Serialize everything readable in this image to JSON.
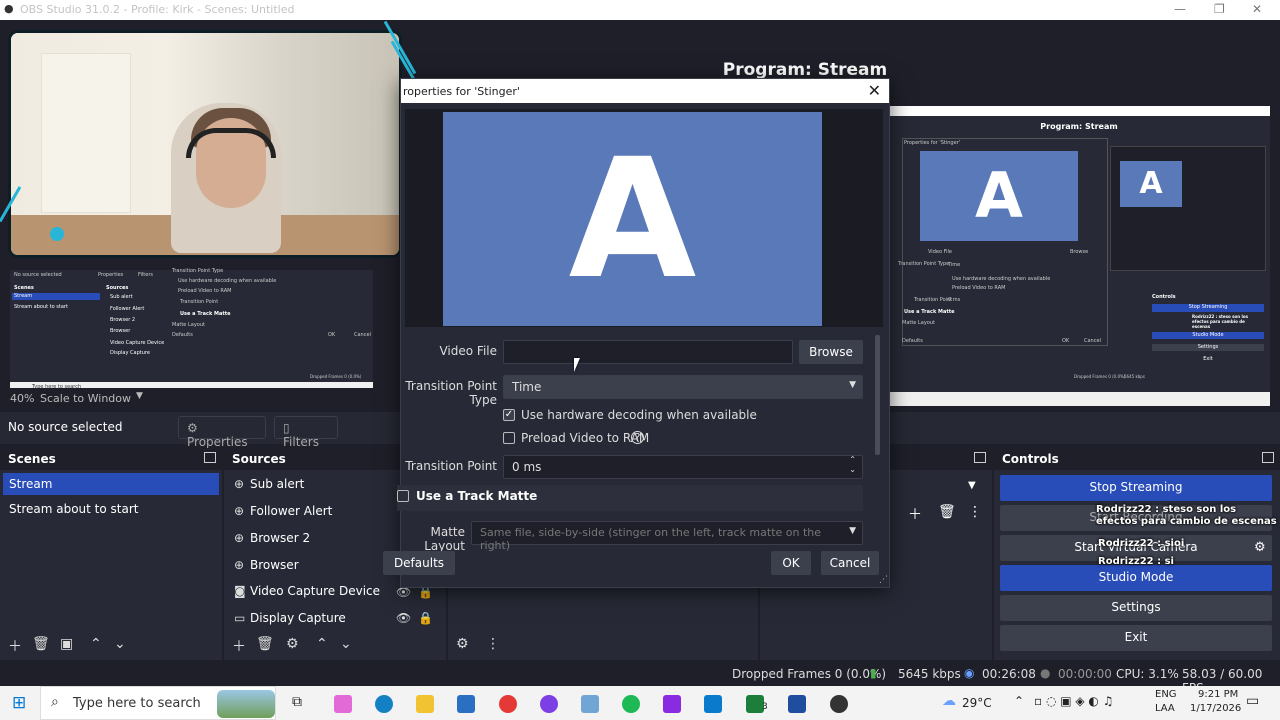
{
  "window": {
    "title": "OBS Studio 31.0.2 - Profile: Kirk - Scenes: Untitled",
    "minimize": "—",
    "maximize": "❐",
    "close": "✕"
  },
  "program_title": "Program: Stream",
  "preview_scale": {
    "zoom": "40%",
    "mode": "Scale to Window"
  },
  "source_toolbar": {
    "no_source": "No source selected",
    "properties": "Properties",
    "filters": "Filters"
  },
  "scenes": {
    "title": "Scenes",
    "items": [
      {
        "label": "Stream"
      },
      {
        "label": "Stream about to start"
      }
    ]
  },
  "sources": {
    "title": "Sources",
    "items": [
      {
        "label": "Sub alert",
        "icon": "globe-icon"
      },
      {
        "label": "Follower Alert",
        "icon": "globe-icon"
      },
      {
        "label": "Browser 2",
        "icon": "globe-icon"
      },
      {
        "label": "Browser",
        "icon": "globe-icon"
      },
      {
        "label": "Video Capture Device",
        "icon": "camera-icon"
      },
      {
        "label": "Display Capture",
        "icon": "monitor-icon"
      }
    ]
  },
  "controls": {
    "title": "Controls",
    "stop_streaming": "Stop Streaming",
    "start_recording": "Start Recording",
    "start_virtual_camera": "Start Virtual Camera",
    "studio_mode": "Studio Mode",
    "settings": "Settings",
    "exit": "Exit"
  },
  "chat_overlay": [
    "Rodrizz22 : steso son los efectos para cambio de escenas",
    "Rodrizz22 : sioi",
    "Rodrizz22 : si"
  ],
  "dialog": {
    "title": "roperties for 'Stinger'",
    "preview_letter": "A",
    "video_file_label": "Video File",
    "video_file_value": "",
    "browse": "Browse",
    "transition_point_type_label": "Transition Point Type",
    "transition_point_type_value": "Time",
    "hw_decoding": "Use hardware decoding when available",
    "hw_decoding_checked": true,
    "preload": "Preload Video to RAM",
    "preload_checked": false,
    "transition_point_label": "Transition Point",
    "transition_point_value": "0 ms",
    "track_matte": "Use a Track Matte",
    "track_matte_checked": false,
    "matte_layout_label": "Matte Layout",
    "matte_layout_value": "Same file, side-by-side (stinger on the left, track matte on the right)",
    "defaults": "Defaults",
    "ok": "OK",
    "cancel": "Cancel"
  },
  "mini_preview": {
    "title": "Program: Stream",
    "letter": "A",
    "dialog_title": "Properties for 'Stinger'",
    "video_file": "Video File",
    "browse": "Browse",
    "transition_point_type": "Transition Point Type",
    "time": "Time",
    "hw": "Use hardware decoding when available",
    "preload": "Preload Video to RAM",
    "transition_point": "Transition Point",
    "ms": "0 ms",
    "track_matte": "Use a Track Matte",
    "matte_layout": "Matte Layout",
    "defaults": "Defaults",
    "ok": "OK",
    "cancel": "Cancel",
    "controls": "Controls",
    "stop": "Stop Streaming",
    "studio": "Studio Mode",
    "settings": "Settings",
    "exit": "Exit",
    "chat1": "Rodrizz22 : steso son los efectos para cambio de escenas",
    "chat2": "Rodrizz22 : sioi",
    "chat3": "Rodrizz22 : si",
    "dropped": "Dropped Frames 0 (0.0%)",
    "kbps": "5645 kbps",
    "left_scenes": "Scenes",
    "left_sources": "Sources",
    "left_nosrc": "No source selected",
    "left_stream": "Stream",
    "left_about": "Stream about to start",
    "left_props": "Properties",
    "left_filters": "Filters",
    "left_tp": "Transition Point",
    "left_tpt": "Transition Point Type",
    "left_hw": "Use hardware decoding when available",
    "left_preload": "Preload Video to RAM",
    "left_matte": "Use a Track Matte",
    "left_layout": "Matte Layout",
    "left_sub": "Sub alert",
    "left_follower": "Follower Alert",
    "left_browser2": "Browser 2",
    "left_browser": "Browser",
    "left_vcd": "Video Capture Device",
    "left_display": "Display Capture",
    "left_defaults": "Defaults",
    "left_ok": "OK",
    "left_cancel": "Cancel",
    "left_search": "Type here to search",
    "left_dropped": "Dropped Frames 0 (0.0%)"
  },
  "status": {
    "dropped_frames": "Dropped Frames 0 (0.0%)",
    "kbps": "5645 kbps",
    "stream_time": "00:26:08",
    "rec_time": "00:00:00",
    "cpu": "CPU: 3.1%",
    "fps": "58.03 / 60.00 FPS"
  },
  "taskbar": {
    "search_placeholder": "Type here to search",
    "weather": "29°C",
    "lang": "ENG",
    "lang2": "LAA",
    "time": "9:21 PM",
    "date": "1/17/2026",
    "badge": "3"
  },
  "colors": {
    "accent": "#284cb8",
    "bg": "#1e1f29",
    "panel": "#272a36",
    "stinger": "#5a79b8",
    "cyan": "#27b6d8"
  }
}
